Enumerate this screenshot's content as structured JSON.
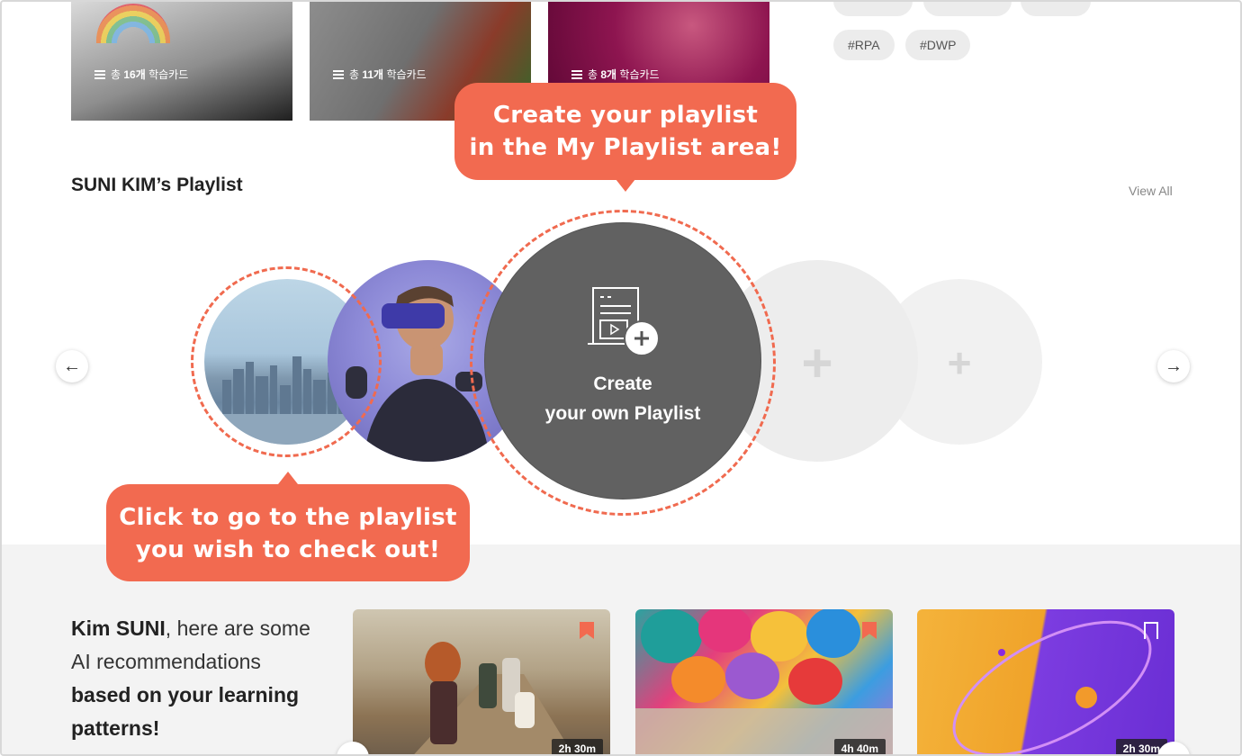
{
  "top_cards": [
    {
      "count_prefix": "총 ",
      "count_value": "16개",
      "count_suffix": " 학습카드"
    },
    {
      "count_prefix": "총 ",
      "count_value": "11개",
      "count_suffix": " 학습카드"
    },
    {
      "count_prefix": "총 ",
      "count_value": "8개",
      "count_suffix": " 학습카드"
    }
  ],
  "tags": [
    "#RPA",
    "#DWP"
  ],
  "playlist_section": {
    "title": "SUNI KIM’s Playlist",
    "view_all": "View All",
    "create_line1": "Create",
    "create_line2": "your own Playlist"
  },
  "callouts": {
    "create_line1": "Create your playlist",
    "create_line2": "in the My Playlist area!",
    "click_line1": "Click to go to the playlist",
    "click_line2": "you wish to check out!"
  },
  "recommendations": {
    "name": "Kim SUNI",
    "intro_rest": ", here are some",
    "line2": "AI recommendations",
    "line3": "based on your learning",
    "line4": "patterns!",
    "cards": [
      {
        "duration": "2h 30m"
      },
      {
        "duration": "4h 40m"
      },
      {
        "duration": "2h 30m"
      }
    ]
  },
  "colors": {
    "accent": "#f26a50",
    "create_circle": "#616161",
    "band": "#f3f3f3"
  }
}
